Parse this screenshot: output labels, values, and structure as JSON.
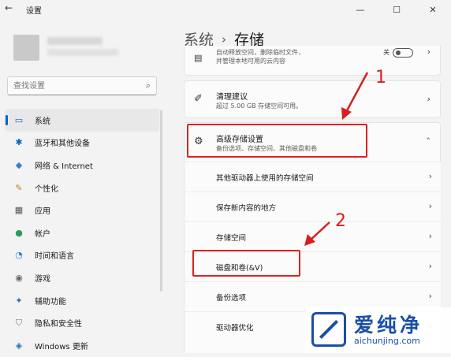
{
  "window": {
    "title": "设置",
    "back_icon": "←",
    "controls": [
      "—",
      "☐",
      "✕"
    ]
  },
  "search": {
    "placeholder": "查找设置",
    "icon": "⌕"
  },
  "nav": {
    "items": [
      {
        "icon": "▭",
        "label": "系统",
        "active": true,
        "color": "#0067c0"
      },
      {
        "icon": "✱",
        "label": "蓝牙和其他设备",
        "color": "#0067c0"
      },
      {
        "icon": "◆",
        "label": "网络 & Internet",
        "color": "#3a7bd5"
      },
      {
        "icon": "✎",
        "label": "个性化",
        "color": "#c87a2a"
      },
      {
        "icon": "▦",
        "label": "应用",
        "color": "#555555"
      },
      {
        "icon": "●",
        "label": "帐户",
        "color": "#2e9b5a"
      },
      {
        "icon": "◔",
        "label": "时间和语言",
        "color": "#1f7fc2"
      },
      {
        "icon": "◉",
        "label": "游戏",
        "color": "#666666"
      },
      {
        "icon": "✦",
        "label": "辅助功能",
        "color": "#1f6fb5"
      },
      {
        "icon": "⛉",
        "label": "隐私和安全性",
        "color": "#777777"
      },
      {
        "icon": "◈",
        "label": "Windows 更新",
        "color": "#1f6fb5"
      }
    ]
  },
  "breadcrumb": {
    "parent": "系统",
    "separator": "›",
    "current": "存储"
  },
  "storage_sense": {
    "line1": "自动释放空间，删除临时文件，",
    "line2": "并管理本地可用的云内容",
    "toggle_label": "关",
    "chevron": "›"
  },
  "cleanup": {
    "icon": "✐",
    "title": "清理建议",
    "subtitle": "超过 5.00 GB 存储空间可用。",
    "chevron": "›"
  },
  "advanced": {
    "icon": "⚙",
    "title": "高级存储设置",
    "subtitle": "备份选项、存储空间、其他磁盘和卷",
    "chevron": "˄",
    "subitems": [
      {
        "label": "其他驱动器上使用的存储空间",
        "chevron": "›"
      },
      {
        "label": "保存新内容的地方",
        "chevron": "›"
      },
      {
        "label": "存储空间",
        "chevron": "›"
      },
      {
        "label": "磁盘和卷(&V)",
        "chevron": "›"
      },
      {
        "label": "备份选项",
        "chevron": "›"
      },
      {
        "label": "驱动器优化",
        "chevron": "›"
      }
    ]
  },
  "annotations": {
    "label1": "1",
    "label2": "2",
    "color": "#d81e1e"
  },
  "watermark": {
    "brand": "爱纯净",
    "url": "aichunjing.com",
    "color": "#1a4fa8"
  }
}
